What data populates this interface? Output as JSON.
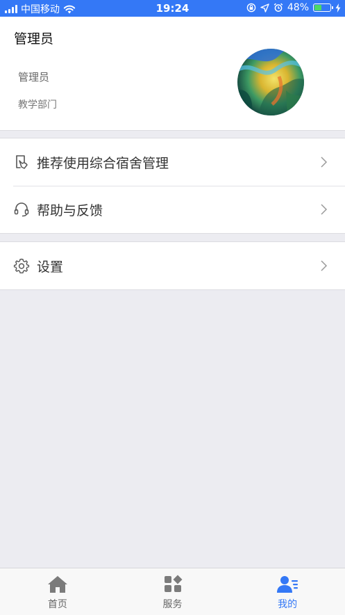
{
  "status_bar": {
    "carrier": "中国移动",
    "time": "19:24",
    "battery_text": "48%",
    "battery_level": 0.48
  },
  "profile": {
    "title": "管理员",
    "name": "管理员",
    "department": "教学部门"
  },
  "menu": {
    "recommend_label": "推荐使用综合宿舍管理",
    "help_label": "帮助与反馈",
    "settings_label": "设置"
  },
  "tabbar": {
    "home_label": "首页",
    "service_label": "服务",
    "mine_label": "我的"
  },
  "colors": {
    "accent": "#3478f6",
    "battery": "#4cd964",
    "tab_inactive_icon": "#7b7b7b"
  }
}
